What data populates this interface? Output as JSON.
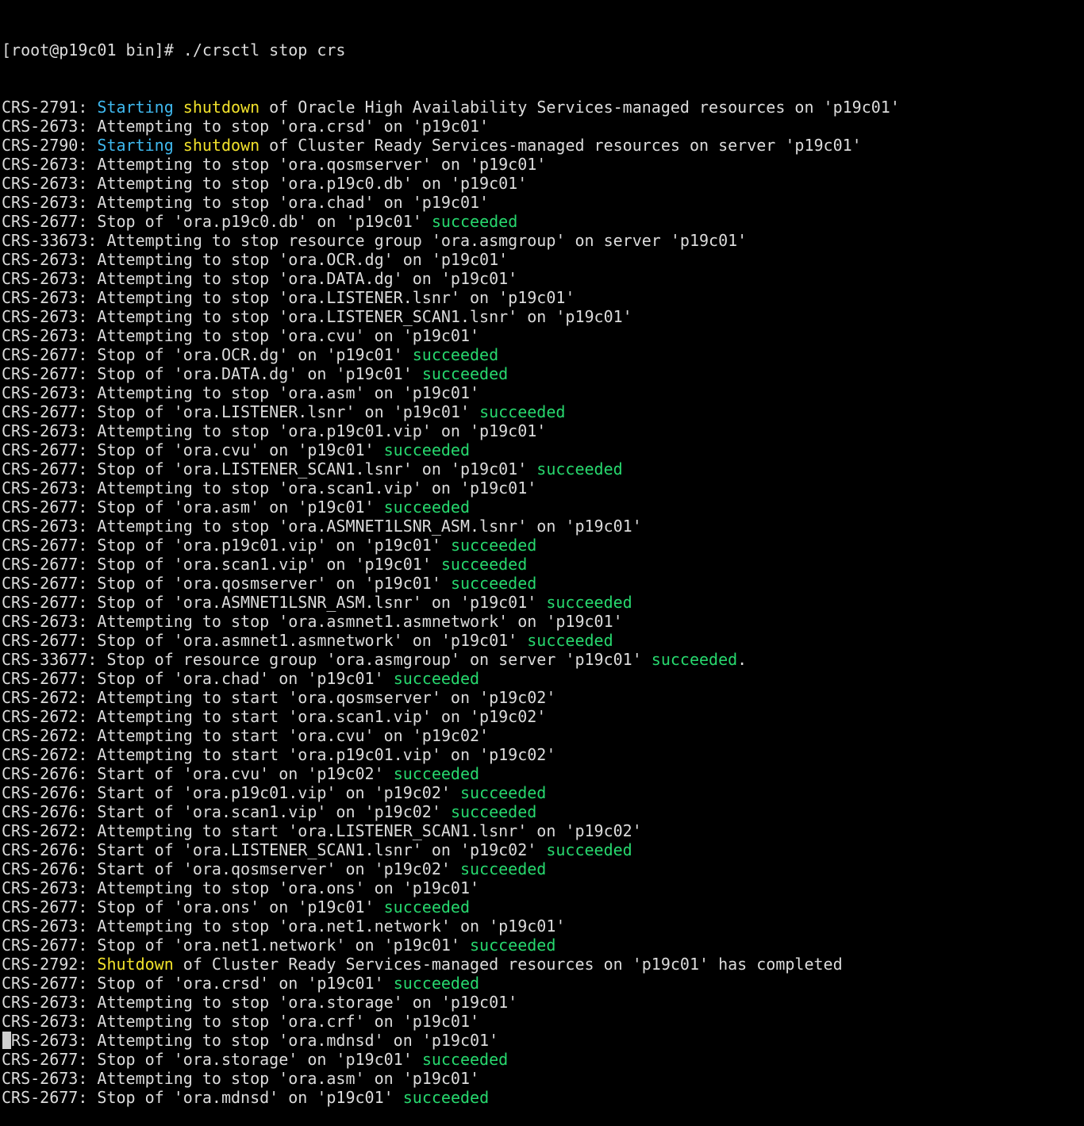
{
  "colors": {
    "background": "#000000",
    "default": "#dcdcdc",
    "blue": "#3fb8ee",
    "yellow": "#f2e22b",
    "green": "#27d86e"
  },
  "prompt": "[root@p19c01 bin]# ./crsctl stop crs",
  "lines": [
    [
      {
        "t": "CRS-2791: ",
        "c": "default"
      },
      {
        "t": "Starting",
        "c": "blue"
      },
      {
        "t": " ",
        "c": "default"
      },
      {
        "t": "shutdown",
        "c": "yellow"
      },
      {
        "t": " of Oracle High Availability Services-managed resources on 'p19c01'",
        "c": "default"
      }
    ],
    [
      {
        "t": "CRS-2673: Attempting to stop 'ora.crsd' on 'p19c01'",
        "c": "default"
      }
    ],
    [
      {
        "t": "CRS-2790: ",
        "c": "default"
      },
      {
        "t": "Starting",
        "c": "blue"
      },
      {
        "t": " ",
        "c": "default"
      },
      {
        "t": "shutdown",
        "c": "yellow"
      },
      {
        "t": " of Cluster Ready Services-managed resources on server 'p19c01'",
        "c": "default"
      }
    ],
    [
      {
        "t": "CRS-2673: Attempting to stop 'ora.qosmserver' on 'p19c01'",
        "c": "default"
      }
    ],
    [
      {
        "t": "CRS-2673: Attempting to stop 'ora.p19c0.db' on 'p19c01'",
        "c": "default"
      }
    ],
    [
      {
        "t": "CRS-2673: Attempting to stop 'ora.chad' on 'p19c01'",
        "c": "default"
      }
    ],
    [
      {
        "t": "CRS-2677: Stop of 'ora.p19c0.db' on 'p19c01' ",
        "c": "default"
      },
      {
        "t": "succeeded",
        "c": "green"
      }
    ],
    [
      {
        "t": "CRS-33673: Attempting to stop resource group 'ora.asmgroup' on server 'p19c01'",
        "c": "default"
      }
    ],
    [
      {
        "t": "CRS-2673: Attempting to stop 'ora.OCR.dg' on 'p19c01'",
        "c": "default"
      }
    ],
    [
      {
        "t": "CRS-2673: Attempting to stop 'ora.DATA.dg' on 'p19c01'",
        "c": "default"
      }
    ],
    [
      {
        "t": "CRS-2673: Attempting to stop 'ora.LISTENER.lsnr' on 'p19c01'",
        "c": "default"
      }
    ],
    [
      {
        "t": "CRS-2673: Attempting to stop 'ora.LISTENER_SCAN1.lsnr' on 'p19c01'",
        "c": "default"
      }
    ],
    [
      {
        "t": "CRS-2673: Attempting to stop 'ora.cvu' on 'p19c01'",
        "c": "default"
      }
    ],
    [
      {
        "t": "CRS-2677: Stop of 'ora.OCR.dg' on 'p19c01' ",
        "c": "default"
      },
      {
        "t": "succeeded",
        "c": "green"
      }
    ],
    [
      {
        "t": "CRS-2677: Stop of 'ora.DATA.dg' on 'p19c01' ",
        "c": "default"
      },
      {
        "t": "succeeded",
        "c": "green"
      }
    ],
    [
      {
        "t": "CRS-2673: Attempting to stop 'ora.asm' on 'p19c01'",
        "c": "default"
      }
    ],
    [
      {
        "t": "CRS-2677: Stop of 'ora.LISTENER.lsnr' on 'p19c01' ",
        "c": "default"
      },
      {
        "t": "succeeded",
        "c": "green"
      }
    ],
    [
      {
        "t": "CRS-2673: Attempting to stop 'ora.p19c01.vip' on 'p19c01'",
        "c": "default"
      }
    ],
    [
      {
        "t": "CRS-2677: Stop of 'ora.cvu' on 'p19c01' ",
        "c": "default"
      },
      {
        "t": "succeeded",
        "c": "green"
      }
    ],
    [
      {
        "t": "CRS-2677: Stop of 'ora.LISTENER_SCAN1.lsnr' on 'p19c01' ",
        "c": "default"
      },
      {
        "t": "succeeded",
        "c": "green"
      }
    ],
    [
      {
        "t": "CRS-2673: Attempting to stop 'ora.scan1.vip' on 'p19c01'",
        "c": "default"
      }
    ],
    [
      {
        "t": "CRS-2677: Stop of 'ora.asm' on 'p19c01' ",
        "c": "default"
      },
      {
        "t": "succeeded",
        "c": "green"
      }
    ],
    [
      {
        "t": "CRS-2673: Attempting to stop 'ora.ASMNET1LSNR_ASM.lsnr' on 'p19c01'",
        "c": "default"
      }
    ],
    [
      {
        "t": "CRS-2677: Stop of 'ora.p19c01.vip' on 'p19c01' ",
        "c": "default"
      },
      {
        "t": "succeeded",
        "c": "green"
      }
    ],
    [
      {
        "t": "CRS-2677: Stop of 'ora.scan1.vip' on 'p19c01' ",
        "c": "default"
      },
      {
        "t": "succeeded",
        "c": "green"
      }
    ],
    [
      {
        "t": "CRS-2677: Stop of 'ora.qosmserver' on 'p19c01' ",
        "c": "default"
      },
      {
        "t": "succeeded",
        "c": "green"
      }
    ],
    [
      {
        "t": "CRS-2677: Stop of 'ora.ASMNET1LSNR_ASM.lsnr' on 'p19c01' ",
        "c": "default"
      },
      {
        "t": "succeeded",
        "c": "green"
      }
    ],
    [
      {
        "t": "CRS-2673: Attempting to stop 'ora.asmnet1.asmnetwork' on 'p19c01'",
        "c": "default"
      }
    ],
    [
      {
        "t": "CRS-2677: Stop of 'ora.asmnet1.asmnetwork' on 'p19c01' ",
        "c": "default"
      },
      {
        "t": "succeeded",
        "c": "green"
      }
    ],
    [
      {
        "t": "CRS-33677: Stop of resource group 'ora.asmgroup' on server 'p19c01' ",
        "c": "default"
      },
      {
        "t": "succeeded",
        "c": "green"
      },
      {
        "t": ".",
        "c": "default"
      }
    ],
    [
      {
        "t": "CRS-2677: Stop of 'ora.chad' on 'p19c01' ",
        "c": "default"
      },
      {
        "t": "succeeded",
        "c": "green"
      }
    ],
    [
      {
        "t": "CRS-2672: Attempting to start 'ora.qosmserver' on 'p19c02'",
        "c": "default"
      }
    ],
    [
      {
        "t": "CRS-2672: Attempting to start 'ora.scan1.vip' on 'p19c02'",
        "c": "default"
      }
    ],
    [
      {
        "t": "CRS-2672: Attempting to start 'ora.cvu' on 'p19c02'",
        "c": "default"
      }
    ],
    [
      {
        "t": "CRS-2672: Attempting to start 'ora.p19c01.vip' on 'p19c02'",
        "c": "default"
      }
    ],
    [
      {
        "t": "CRS-2676: Start of 'ora.cvu' on 'p19c02' ",
        "c": "default"
      },
      {
        "t": "succeeded",
        "c": "green"
      }
    ],
    [
      {
        "t": "CRS-2676: Start of 'ora.p19c01.vip' on 'p19c02' ",
        "c": "default"
      },
      {
        "t": "succeeded",
        "c": "green"
      }
    ],
    [
      {
        "t": "CRS-2676: Start of 'ora.scan1.vip' on 'p19c02' ",
        "c": "default"
      },
      {
        "t": "succeeded",
        "c": "green"
      }
    ],
    [
      {
        "t": "CRS-2672: Attempting to start 'ora.LISTENER_SCAN1.lsnr' on 'p19c02'",
        "c": "default"
      }
    ],
    [
      {
        "t": "CRS-2676: Start of 'ora.LISTENER_SCAN1.lsnr' on 'p19c02' ",
        "c": "default"
      },
      {
        "t": "succeeded",
        "c": "green"
      }
    ],
    [
      {
        "t": "CRS-2676: Start of 'ora.qosmserver' on 'p19c02' ",
        "c": "default"
      },
      {
        "t": "succeeded",
        "c": "green"
      }
    ],
    [
      {
        "t": "CRS-2673: Attempting to stop 'ora.ons' on 'p19c01'",
        "c": "default"
      }
    ],
    [
      {
        "t": "CRS-2677: Stop of 'ora.ons' on 'p19c01' ",
        "c": "default"
      },
      {
        "t": "succeeded",
        "c": "green"
      }
    ],
    [
      {
        "t": "CRS-2673: Attempting to stop 'ora.net1.network' on 'p19c01'",
        "c": "default"
      }
    ],
    [
      {
        "t": "CRS-2677: Stop of 'ora.net1.network' on 'p19c01' ",
        "c": "default"
      },
      {
        "t": "succeeded",
        "c": "green"
      }
    ],
    [
      {
        "t": "CRS-2792: ",
        "c": "default"
      },
      {
        "t": "Shutdown",
        "c": "yellow"
      },
      {
        "t": " of Cluster Ready Services-managed resources on 'p19c01' has completed",
        "c": "default"
      }
    ],
    [
      {
        "t": "CRS-2677: Stop of 'ora.crsd' on 'p19c01' ",
        "c": "default"
      },
      {
        "t": "succeeded",
        "c": "green"
      }
    ],
    [
      {
        "t": "CRS-2673: Attempting to stop 'ora.storage' on 'p19c01'",
        "c": "default"
      }
    ],
    [
      {
        "t": "CRS-2673: Attempting to stop 'ora.crf' on 'p19c01'",
        "c": "default"
      }
    ],
    [
      {
        "t": "CRS-2673: Attempting to stop 'ora.mdnsd' on 'p19c01'",
        "c": "default"
      }
    ],
    [
      {
        "t": "CRS-2677: Stop of 'ora.storage' on 'p19c01' ",
        "c": "default"
      },
      {
        "t": "succeeded",
        "c": "green"
      }
    ],
    [
      {
        "t": "CRS-2673: Attempting to stop 'ora.asm' on 'p19c01'",
        "c": "default"
      }
    ],
    [
      {
        "t": "CRS-2677: Stop of 'ora.mdnsd' on 'p19c01' ",
        "c": "default"
      },
      {
        "t": "succeeded",
        "c": "green"
      }
    ]
  ]
}
